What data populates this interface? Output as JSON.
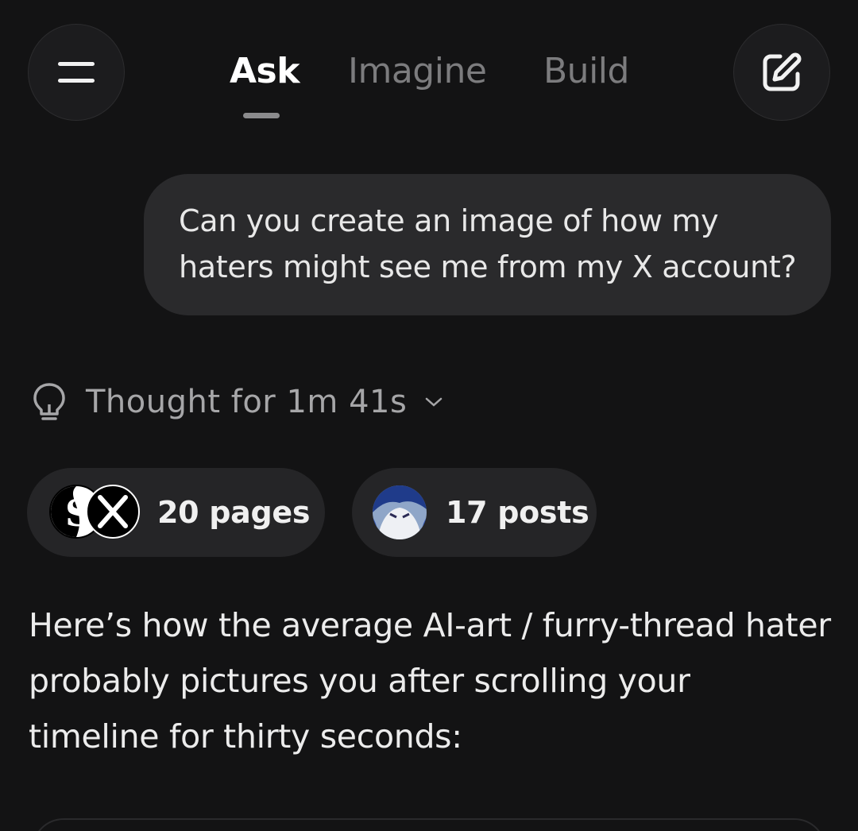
{
  "header": {
    "tabs": [
      {
        "label": "Ask",
        "active": true
      },
      {
        "label": "Imagine",
        "active": false
      },
      {
        "label": "Build",
        "active": false
      }
    ],
    "menu_icon": "menu-icon",
    "compose_icon": "edit-icon"
  },
  "conversation": {
    "user_message_line1": "Can you create an image of how my",
    "user_message_line2": "haters might see me from my X account?",
    "thought_label": "Thought for 1m 41s",
    "sources": {
      "pages_label": "20 pages",
      "posts_label": "17 posts"
    },
    "response_line1": "Here’s how the average AI-art / furry-thread hater",
    "response_line2": "probably pictures you after scrolling your",
    "response_line3": "timeline for thirty seconds:"
  },
  "colors": {
    "background": "#131314",
    "bubble": "#2a2a2c",
    "chip": "#252527",
    "muted_text": "#7c7c7e"
  }
}
